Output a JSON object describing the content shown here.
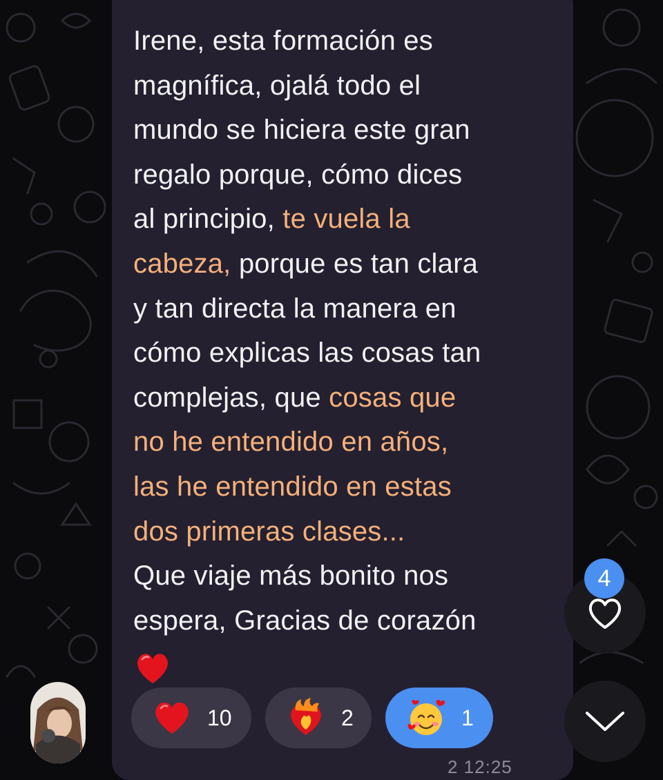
{
  "message": {
    "lines": [
      [
        {
          "t": "Irene, esta formación es",
          "h": false
        }
      ],
      [
        {
          "t": "magnífica, ojalá todo el",
          "h": false
        }
      ],
      [
        {
          "t": "mundo se hiciera este gran",
          "h": false
        }
      ],
      [
        {
          "t": "regalo porque, cómo dices",
          "h": false
        }
      ],
      [
        {
          "t": "al principio, ",
          "h": false
        },
        {
          "t": "te vuela la",
          "h": true
        }
      ],
      [
        {
          "t": "cabeza,",
          "h": true
        },
        {
          "t": " porque es tan clara",
          "h": false
        }
      ],
      [
        {
          "t": "y tan directa la manera en",
          "h": false
        }
      ],
      [
        {
          "t": "cómo explicas las cosas tan",
          "h": false
        }
      ],
      [
        {
          "t": "complejas, que ",
          "h": false
        },
        {
          "t": "cosas que",
          "h": true
        }
      ],
      [
        {
          "t": "no he entendido en años,",
          "h": true
        }
      ],
      [
        {
          "t": "las he entendido en estas",
          "h": true
        }
      ],
      [
        {
          "t": "dos primeras clases...",
          "h": true
        }
      ],
      [
        {
          "t": " Que viaje más bonito nos",
          "h": false
        }
      ],
      [
        {
          "t": "espera, Gracias de corazón",
          "h": false
        }
      ]
    ],
    "trailing_emoji": "red-heart-emoji",
    "time": "2 12:25"
  },
  "reactions": [
    {
      "emoji": "red-heart",
      "count": "10",
      "active": false
    },
    {
      "emoji": "heart-on-fire",
      "count": "2",
      "active": false
    },
    {
      "emoji": "smiling-face-with-hearts",
      "count": "1",
      "active": true
    }
  ],
  "fab": {
    "unread_reactions_badge": "4",
    "reactions_icon": "heart-outline-icon",
    "scroll_icon": "chevron-down-icon"
  },
  "colors": {
    "background": "#0b0a0c",
    "bubble": "#242030",
    "highlight_text": "#f5b07a",
    "accent": "#4b8ff0",
    "reaction_pill": "#3b3747"
  }
}
